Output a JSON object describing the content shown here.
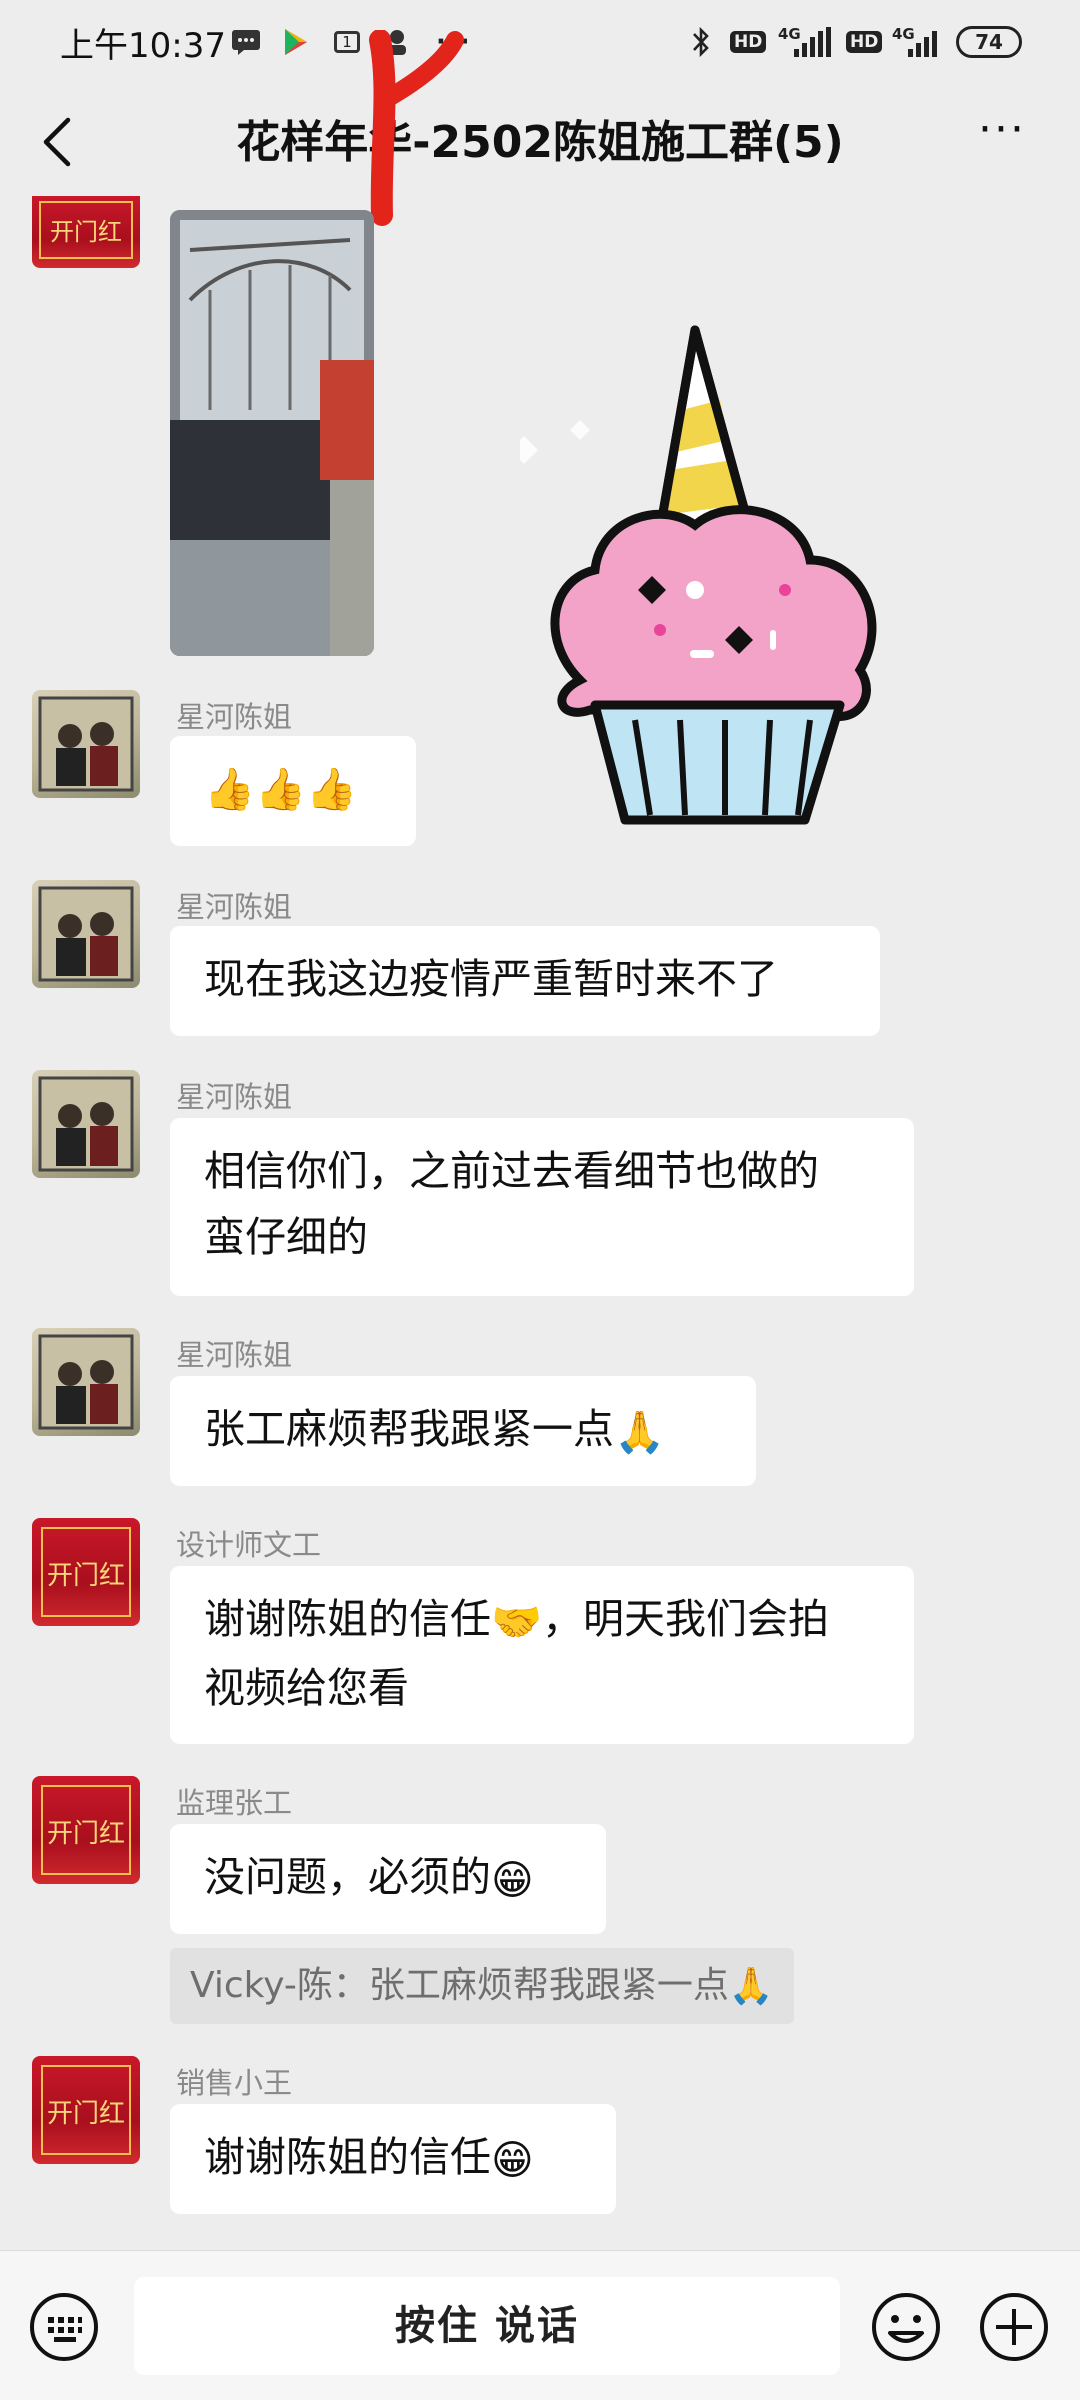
{
  "status_bar": {
    "time": "上午10:37",
    "calendar_badge": "1",
    "more": "···",
    "hd_1": "HD",
    "hd_2": "HD",
    "net_1": "4G",
    "net_2": "4G",
    "battery": "74"
  },
  "header": {
    "title": "花样年华-2502陈姐施工群(5)",
    "more": "···"
  },
  "messages": [
    {
      "sender": "",
      "type": "video"
    },
    {
      "sender": "星河陈姐",
      "text": "👍👍👍"
    },
    {
      "sender": "星河陈姐",
      "text": "现在我这边疫情严重暂时来不了"
    },
    {
      "sender": "星河陈姐",
      "line1": "相信你们，之前过去看细节也做的",
      "line2": "蛮仔细的"
    },
    {
      "sender": "星河陈姐",
      "text": "张工麻烦帮我跟紧一点",
      "emoji": "🙏"
    },
    {
      "sender": "设计师文工",
      "line1_a": "谢谢陈姐的信任",
      "line1_b": "，明天我们会拍",
      "line2": "视频给您看",
      "emoji": "🤝"
    },
    {
      "sender": "监理张工",
      "text": "没问题，必须的",
      "emoji": "😁",
      "quote": "Vicky-陈：张工麻烦帮我跟紧一点",
      "quote_emoji": "🙏"
    },
    {
      "sender": "销售小王",
      "text": "谢谢陈姐的信任",
      "emoji": "😁"
    }
  ],
  "avatars": {
    "red_text": "开门红"
  },
  "bottom_bar": {
    "voice_label": "按住 说话"
  },
  "colors": {
    "background": "#ededed",
    "bubble": "#ffffff",
    "avatar_red": "#c9182a"
  }
}
